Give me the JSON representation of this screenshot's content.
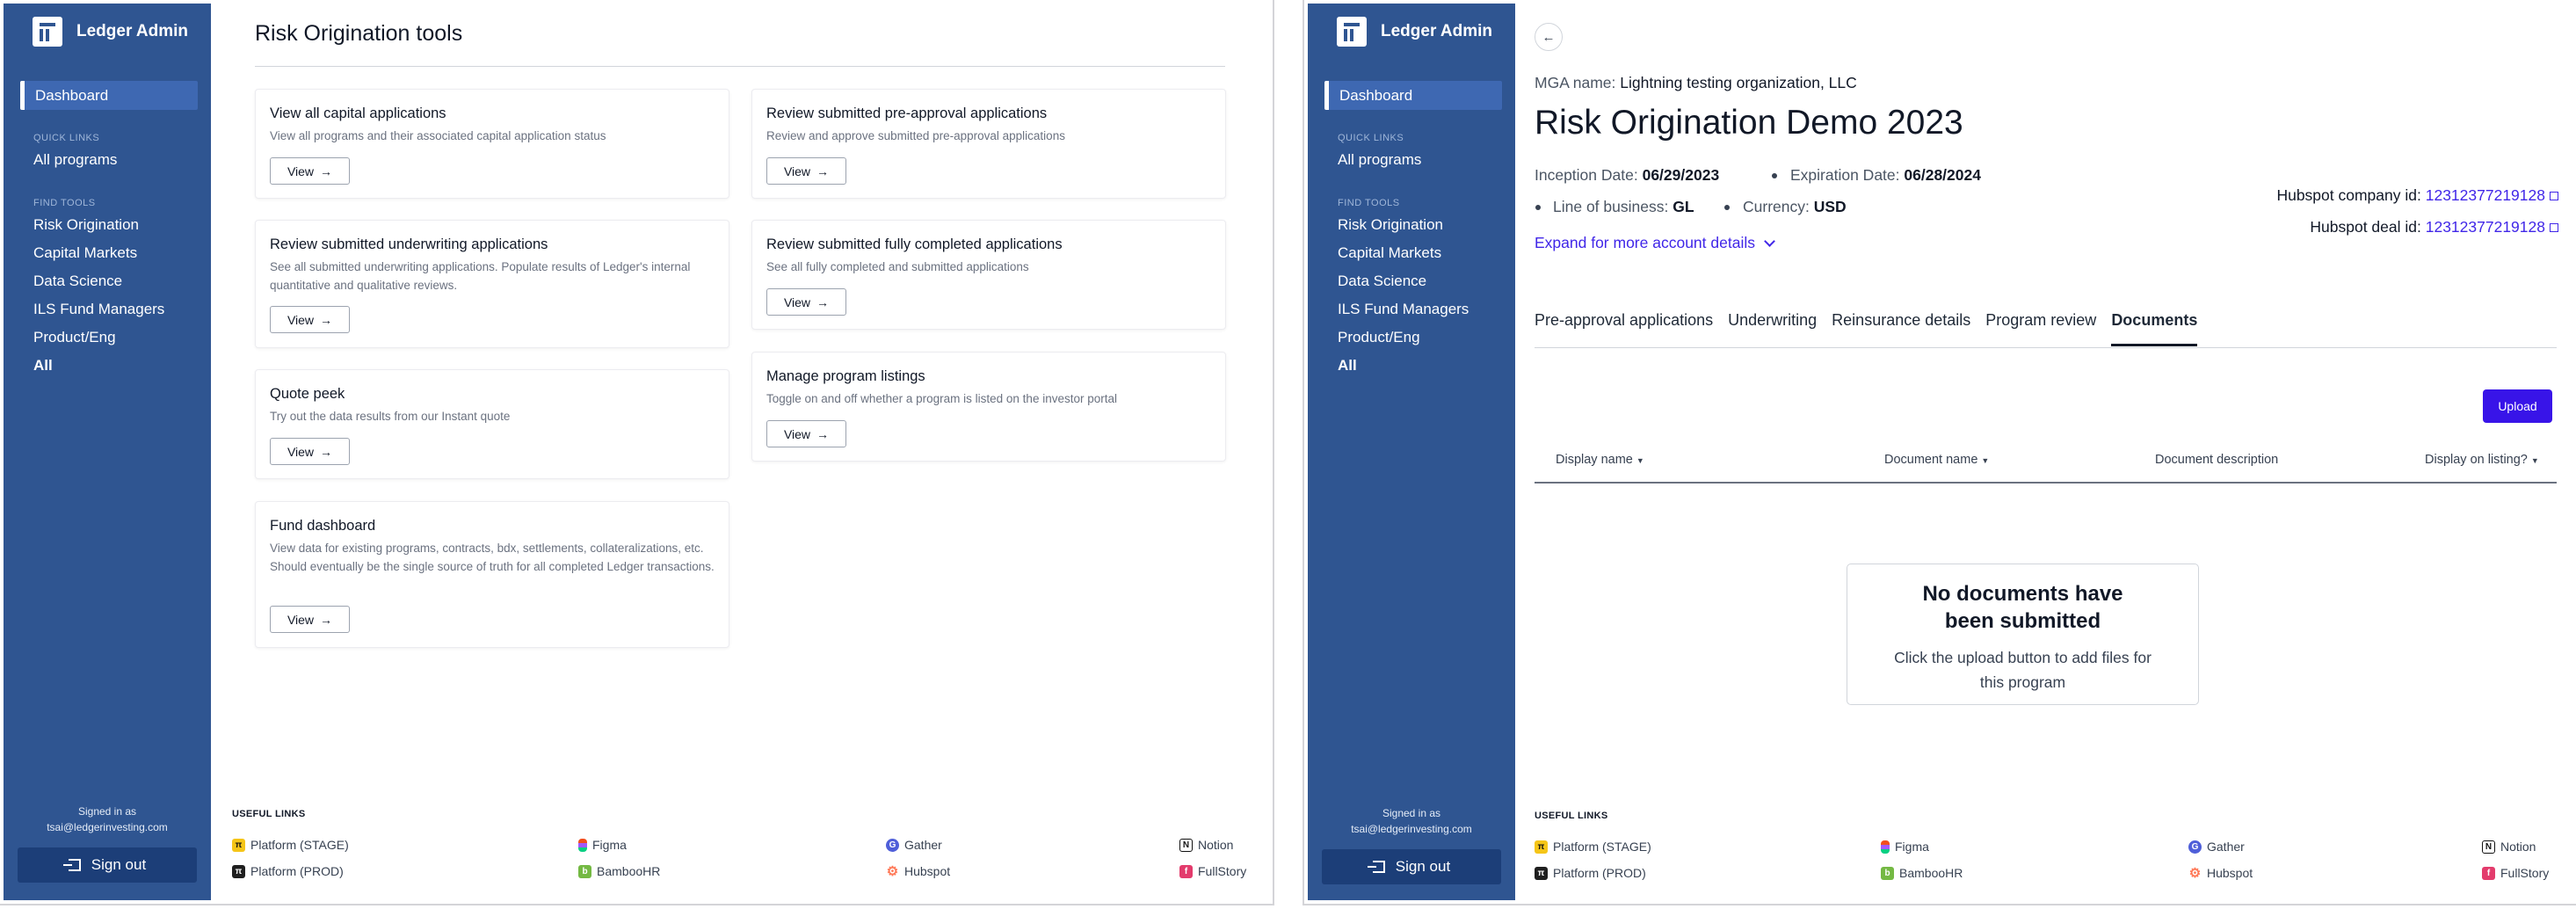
{
  "sidebar": {
    "brand": "Ledger Admin",
    "dashboard": "Dashboard",
    "quick_links_heading": "QUICK LINKS",
    "all_programs": "All programs",
    "find_tools_heading": "FIND TOOLS",
    "tools": [
      "Risk Origination",
      "Capital Markets",
      "Data Science",
      "ILS Fund Managers",
      "Product/Eng",
      "All"
    ],
    "signed_in_label": "Signed in as",
    "signed_in_email": "tsai@ledgerinvesting.com",
    "sign_out": "Sign out"
  },
  "tools_page": {
    "title": "Risk Origination tools",
    "view_label": "View",
    "cards": [
      {
        "title": "View all capital applications",
        "desc": "View all programs and their associated capital application status"
      },
      {
        "title": "Review submitted pre-approval applications",
        "desc": "Review and approve submitted pre-approval applications"
      },
      {
        "title": "Review submitted underwriting applications",
        "desc": "See all submitted underwriting applications. Populate results of Ledger's internal quantitative and qualitative reviews."
      },
      {
        "title": "Review submitted fully completed applications",
        "desc": "See all fully completed and submitted applications"
      },
      {
        "title": "Quote peek",
        "desc": "Try out the data results from our Instant quote"
      },
      {
        "title": "Manage program listings",
        "desc": "Toggle on and off whether a program is listed on the investor portal"
      },
      {
        "title": "Fund dashboard",
        "desc": "View data for existing programs, contracts, bdx, settlements, collateralizations, etc. Should eventually be the single source of truth for all completed Ledger transactions."
      }
    ]
  },
  "useful_links": {
    "heading": "USEFUL LINKS",
    "items": [
      "Platform (STAGE)",
      "Platform (PROD)",
      "Figma",
      "BambooHR",
      "Gather",
      "Hubspot",
      "Notion",
      "FullStory"
    ]
  },
  "program": {
    "mga_label": "MGA name:",
    "mga_value": "Lightning testing organization, LLC",
    "title": "Risk Origination Demo 2023",
    "inception_label": "Inception Date:",
    "inception_value": "06/29/2023",
    "expiration_label": "Expiration Date:",
    "expiration_value": "06/28/2024",
    "lob_label": "Line of business:",
    "lob_value": "GL",
    "currency_label": "Currency:",
    "currency_value": "USD",
    "hubspot_company_label": "Hubspot company id:",
    "hubspot_company_value": "12312377219128",
    "hubspot_deal_label": "Hubspot deal id:",
    "hubspot_deal_value": "12312377219128",
    "expand_label": "Expand for more account details",
    "tabs": [
      "Pre-approval applications",
      "Underwriting",
      "Reinsurance details",
      "Program review",
      "Documents"
    ],
    "active_tab": "Documents",
    "upload": "Upload",
    "columns": [
      "Display name",
      "Document name",
      "Document description",
      "Display on listing?"
    ],
    "empty_title": "No documents have been submitted",
    "empty_desc": "Click the upload button to add files for this program"
  },
  "colors": {
    "sidebar": "#2f5591",
    "accent": "#3814e8",
    "link": "#4026e8"
  }
}
